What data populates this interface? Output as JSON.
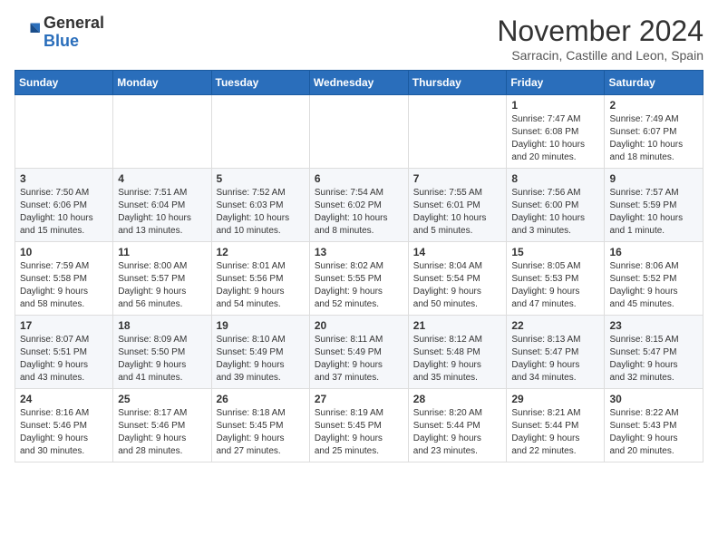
{
  "logo": {
    "general": "General",
    "blue": "Blue"
  },
  "header": {
    "month": "November 2024",
    "location": "Sarracin, Castille and Leon, Spain"
  },
  "weekdays": [
    "Sunday",
    "Monday",
    "Tuesday",
    "Wednesday",
    "Thursday",
    "Friday",
    "Saturday"
  ],
  "weeks": [
    [
      {
        "day": "",
        "info": ""
      },
      {
        "day": "",
        "info": ""
      },
      {
        "day": "",
        "info": ""
      },
      {
        "day": "",
        "info": ""
      },
      {
        "day": "",
        "info": ""
      },
      {
        "day": "1",
        "info": "Sunrise: 7:47 AM\nSunset: 6:08 PM\nDaylight: 10 hours\nand 20 minutes."
      },
      {
        "day": "2",
        "info": "Sunrise: 7:49 AM\nSunset: 6:07 PM\nDaylight: 10 hours\nand 18 minutes."
      }
    ],
    [
      {
        "day": "3",
        "info": "Sunrise: 7:50 AM\nSunset: 6:06 PM\nDaylight: 10 hours\nand 15 minutes."
      },
      {
        "day": "4",
        "info": "Sunrise: 7:51 AM\nSunset: 6:04 PM\nDaylight: 10 hours\nand 13 minutes."
      },
      {
        "day": "5",
        "info": "Sunrise: 7:52 AM\nSunset: 6:03 PM\nDaylight: 10 hours\nand 10 minutes."
      },
      {
        "day": "6",
        "info": "Sunrise: 7:54 AM\nSunset: 6:02 PM\nDaylight: 10 hours\nand 8 minutes."
      },
      {
        "day": "7",
        "info": "Sunrise: 7:55 AM\nSunset: 6:01 PM\nDaylight: 10 hours\nand 5 minutes."
      },
      {
        "day": "8",
        "info": "Sunrise: 7:56 AM\nSunset: 6:00 PM\nDaylight: 10 hours\nand 3 minutes."
      },
      {
        "day": "9",
        "info": "Sunrise: 7:57 AM\nSunset: 5:59 PM\nDaylight: 10 hours\nand 1 minute."
      }
    ],
    [
      {
        "day": "10",
        "info": "Sunrise: 7:59 AM\nSunset: 5:58 PM\nDaylight: 9 hours\nand 58 minutes."
      },
      {
        "day": "11",
        "info": "Sunrise: 8:00 AM\nSunset: 5:57 PM\nDaylight: 9 hours\nand 56 minutes."
      },
      {
        "day": "12",
        "info": "Sunrise: 8:01 AM\nSunset: 5:56 PM\nDaylight: 9 hours\nand 54 minutes."
      },
      {
        "day": "13",
        "info": "Sunrise: 8:02 AM\nSunset: 5:55 PM\nDaylight: 9 hours\nand 52 minutes."
      },
      {
        "day": "14",
        "info": "Sunrise: 8:04 AM\nSunset: 5:54 PM\nDaylight: 9 hours\nand 50 minutes."
      },
      {
        "day": "15",
        "info": "Sunrise: 8:05 AM\nSunset: 5:53 PM\nDaylight: 9 hours\nand 47 minutes."
      },
      {
        "day": "16",
        "info": "Sunrise: 8:06 AM\nSunset: 5:52 PM\nDaylight: 9 hours\nand 45 minutes."
      }
    ],
    [
      {
        "day": "17",
        "info": "Sunrise: 8:07 AM\nSunset: 5:51 PM\nDaylight: 9 hours\nand 43 minutes."
      },
      {
        "day": "18",
        "info": "Sunrise: 8:09 AM\nSunset: 5:50 PM\nDaylight: 9 hours\nand 41 minutes."
      },
      {
        "day": "19",
        "info": "Sunrise: 8:10 AM\nSunset: 5:49 PM\nDaylight: 9 hours\nand 39 minutes."
      },
      {
        "day": "20",
        "info": "Sunrise: 8:11 AM\nSunset: 5:49 PM\nDaylight: 9 hours\nand 37 minutes."
      },
      {
        "day": "21",
        "info": "Sunrise: 8:12 AM\nSunset: 5:48 PM\nDaylight: 9 hours\nand 35 minutes."
      },
      {
        "day": "22",
        "info": "Sunrise: 8:13 AM\nSunset: 5:47 PM\nDaylight: 9 hours\nand 34 minutes."
      },
      {
        "day": "23",
        "info": "Sunrise: 8:15 AM\nSunset: 5:47 PM\nDaylight: 9 hours\nand 32 minutes."
      }
    ],
    [
      {
        "day": "24",
        "info": "Sunrise: 8:16 AM\nSunset: 5:46 PM\nDaylight: 9 hours\nand 30 minutes."
      },
      {
        "day": "25",
        "info": "Sunrise: 8:17 AM\nSunset: 5:46 PM\nDaylight: 9 hours\nand 28 minutes."
      },
      {
        "day": "26",
        "info": "Sunrise: 8:18 AM\nSunset: 5:45 PM\nDaylight: 9 hours\nand 27 minutes."
      },
      {
        "day": "27",
        "info": "Sunrise: 8:19 AM\nSunset: 5:45 PM\nDaylight: 9 hours\nand 25 minutes."
      },
      {
        "day": "28",
        "info": "Sunrise: 8:20 AM\nSunset: 5:44 PM\nDaylight: 9 hours\nand 23 minutes."
      },
      {
        "day": "29",
        "info": "Sunrise: 8:21 AM\nSunset: 5:44 PM\nDaylight: 9 hours\nand 22 minutes."
      },
      {
        "day": "30",
        "info": "Sunrise: 8:22 AM\nSunset: 5:43 PM\nDaylight: 9 hours\nand 20 minutes."
      }
    ]
  ]
}
